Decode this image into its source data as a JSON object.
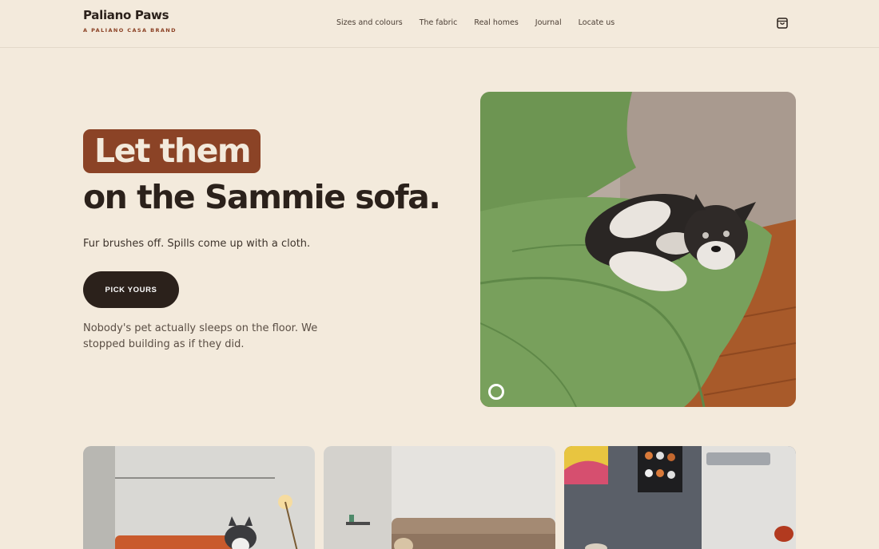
{
  "brand": {
    "name": "Paliano Paws",
    "tagline": "A PALIANO CASA BRAND"
  },
  "nav": {
    "items": [
      {
        "label": "Sizes and colours"
      },
      {
        "label": "The fabric"
      },
      {
        "label": "Real homes"
      },
      {
        "label": "Journal"
      },
      {
        "label": "Locate us"
      }
    ],
    "cart_icon": "shopping-bag-icon"
  },
  "hero": {
    "headline_highlight": "Let them",
    "headline_rest": "on the Sammie sofa.",
    "subhead": "Fur brushes off. Spills come up with a cloth.",
    "cta_label": "PICK YOURS",
    "body": "Nobody's pet actually sleeps on the floor. We stopped building as if they did.",
    "image_description": "dog-on-green-sofa"
  },
  "thumbnails": [
    {
      "image": "husky-on-orange-sofa"
    },
    {
      "image": "dog-on-tan-sofa"
    },
    {
      "image": "living-room-with-dog-posters"
    }
  ],
  "colors": {
    "background": "#f3eadc",
    "accent": "#8b4326",
    "dark": "#2b211b"
  }
}
